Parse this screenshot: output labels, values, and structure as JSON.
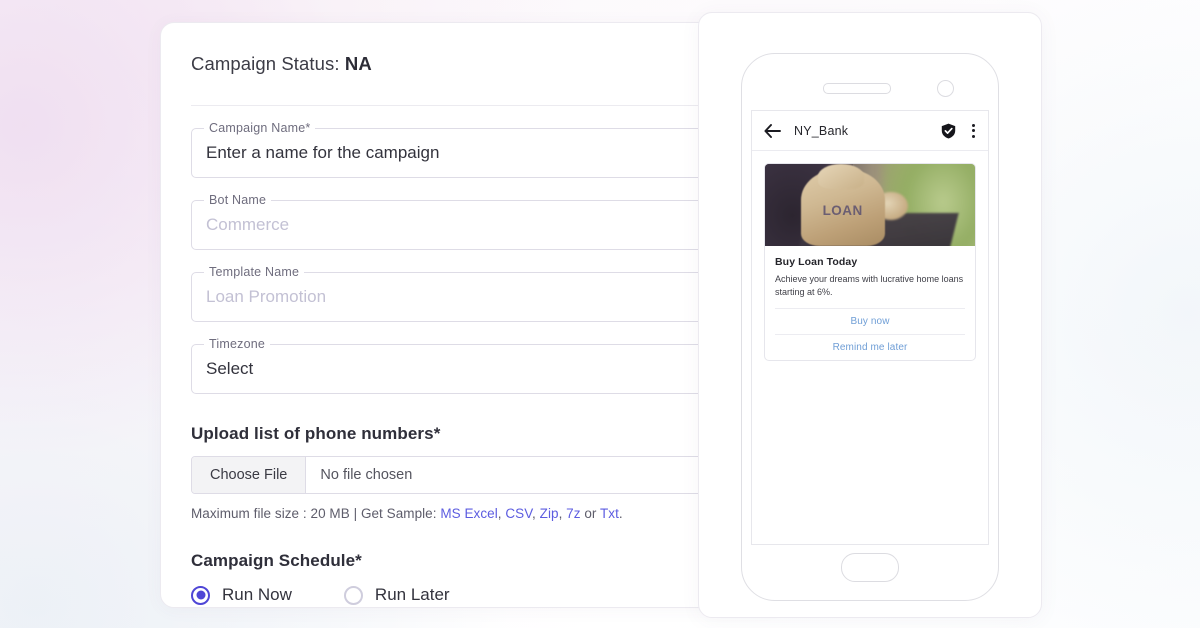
{
  "form": {
    "status_label": "Campaign Status:",
    "status_value": "NA",
    "fields": [
      {
        "legend": "Campaign Name*",
        "value": "Enter a name for the campaign",
        "is_placeholder": false
      },
      {
        "legend": "Bot Name",
        "value": "Commerce",
        "is_placeholder": true
      },
      {
        "legend": "Template Name",
        "value": "Loan Promotion",
        "is_placeholder": true
      },
      {
        "legend": "Timezone",
        "value": "Select",
        "is_placeholder": false
      }
    ],
    "upload": {
      "title": "Upload list of phone numbers*",
      "choose_file_label": "Choose File",
      "no_file_label": "No file chosen",
      "hint_prefix": "Maximum file size : 20 MB | Get Sample: ",
      "samples": [
        "MS Excel",
        "CSV",
        "Zip",
        "7z"
      ],
      "hint_or": " or ",
      "last_sample": "Txt",
      "hint_end": "."
    },
    "schedule": {
      "title": "Campaign Schedule*",
      "options": [
        {
          "label": "Run Now",
          "selected": true
        },
        {
          "label": "Run Later",
          "selected": false
        }
      ]
    }
  },
  "preview": {
    "app_bar": {
      "back_icon": "arrow-left-icon",
      "title": "NY_Bank",
      "verified_icon": "shield-check-icon",
      "menu_icon": "kebab-menu-icon"
    },
    "card": {
      "image_alt": "LOAN money bag on laptop",
      "image_word": "LOAN",
      "title": "Buy Loan Today",
      "description": "Achieve your dreams with lucrative home loans starting at 6%.",
      "actions": [
        "Buy now",
        "Remind me later"
      ]
    }
  },
  "colors": {
    "accent": "#4f46d6",
    "link": "#5c5ce0",
    "card_link": "#6f9ed6",
    "panel_border": "#eceaf0"
  }
}
